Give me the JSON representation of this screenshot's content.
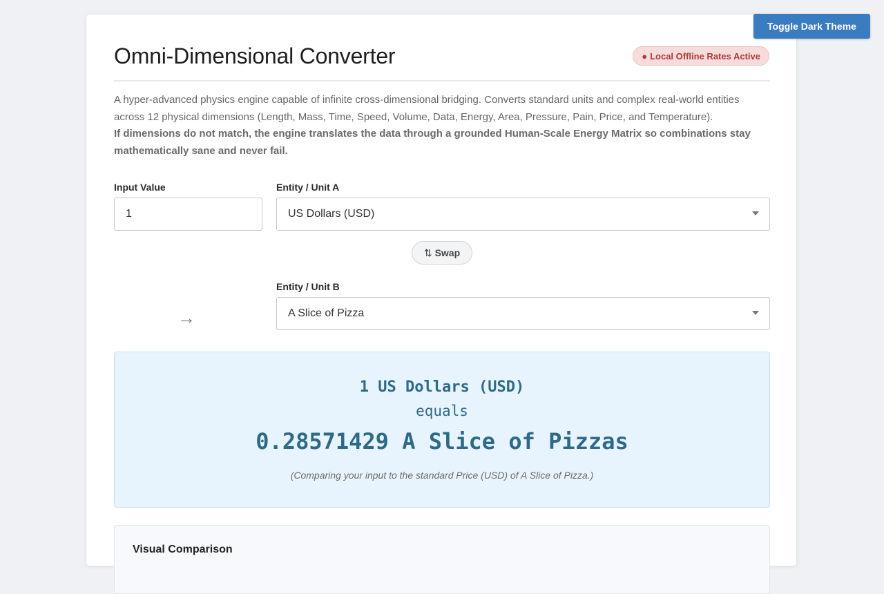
{
  "toggle_theme_label": "Toggle Dark Theme",
  "header": {
    "title": "Omni-Dimensional Converter",
    "badge_dot": "●",
    "badge": "Local Offline Rates Active"
  },
  "description": {
    "text": "A hyper-advanced physics engine capable of infinite cross-dimensional bridging. Converts standard units and complex real-world entities across 12 physical dimensions (Length, Mass, Time, Speed, Volume, Data, Energy, Area, Pressure, Pain, Price, and Temperature).",
    "bold": "If dimensions do not match, the engine translates the data through a grounded Human-Scale Energy Matrix so combinations stay mathematically sane and never fail."
  },
  "form": {
    "input_label": "Input Value",
    "input_value": "1",
    "unit_a_label": "Entity / Unit A",
    "unit_a_value": "US Dollars (USD)",
    "swap_icon": "⇅",
    "swap_label": "Swap",
    "unit_b_label": "Entity / Unit B",
    "unit_b_value": "A Slice of Pizza",
    "arrow": "→"
  },
  "result": {
    "line1": "1 US Dollars (USD)",
    "line2": "equals",
    "line3": "0.28571429 A Slice of Pizzas",
    "note": "(Comparing your input to the standard Price (USD) of A Slice of Pizza.)"
  },
  "visual": {
    "title": "Visual Comparison"
  },
  "colors": {
    "accent": "#3b7bbf",
    "badge_bg": "#f6dcdc",
    "badge_text": "#b23a3a",
    "result_bg": "#e8f4fd",
    "result_text": "#2e6a88"
  },
  "icons": {
    "swap": "swap-vertical-icon",
    "arrow": "arrow-right-icon",
    "select_caret": "caret-down-icon"
  }
}
